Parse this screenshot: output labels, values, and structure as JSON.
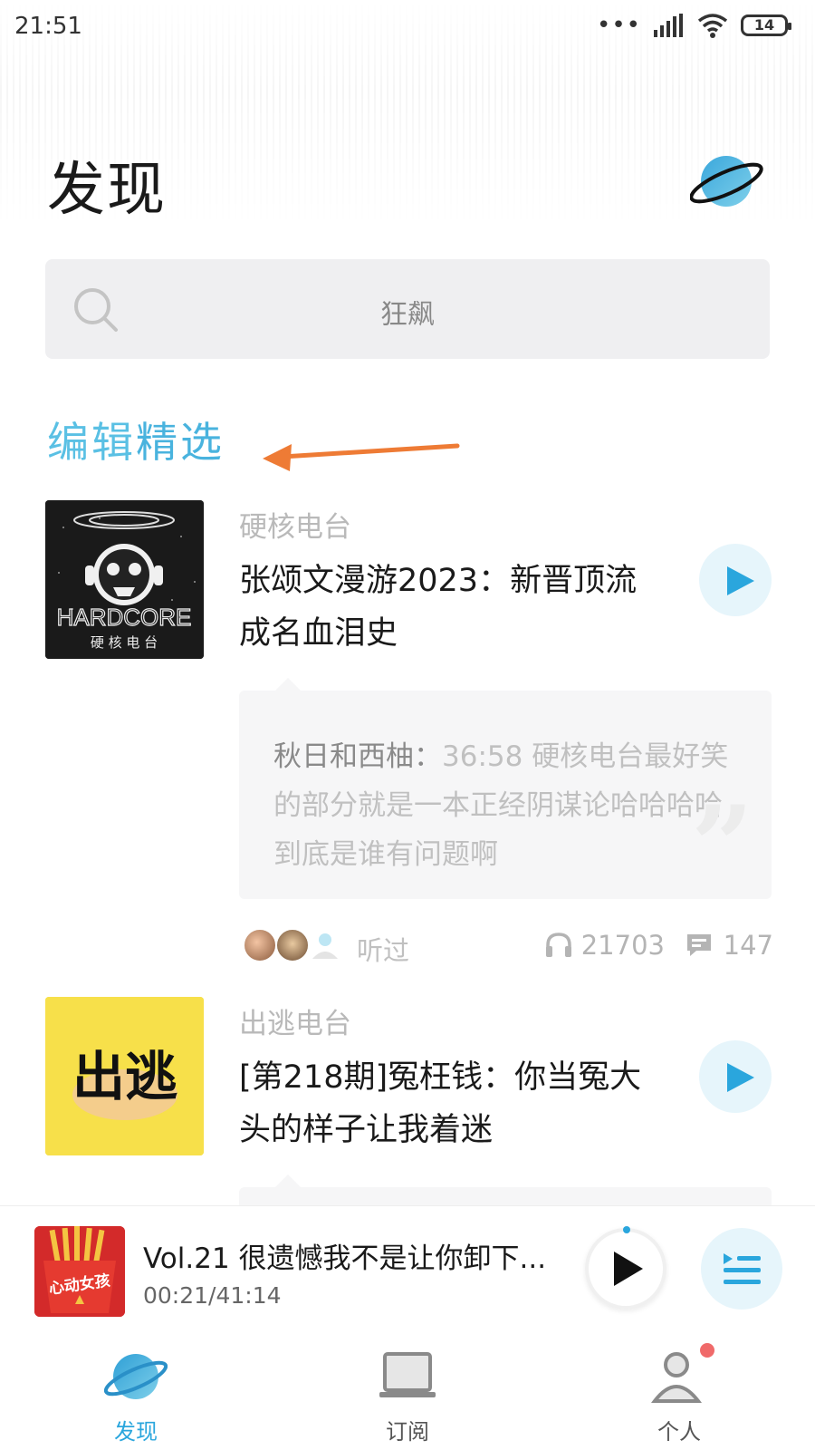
{
  "status_bar": {
    "time": "21:51",
    "battery": "14"
  },
  "header": {
    "title": "发现"
  },
  "search": {
    "placeholder": "狂飙"
  },
  "section": {
    "title_part1": "编辑",
    "title_part2": "精选"
  },
  "episodes": [
    {
      "channel": "硬核电台",
      "title": "张颂文漫游2023：新晋顶流成名血泪史",
      "cover_text": "HARDCORE",
      "cover_subtext": "硬 核 电 台",
      "comment": {
        "author": "秋日和西柚：",
        "text": "36:58 硬核电台最好笑的部分就是一本正经阴谋论哈哈哈哈到底是谁有问题啊"
      },
      "listened_label": "听过",
      "plays": "21703",
      "comments": "147"
    },
    {
      "channel": "出逃电台",
      "title": "[第218期]冤枉钱：你当冤大头的样子让我着迷",
      "cover_text": "出逃"
    }
  ],
  "mini_player": {
    "title": "Vol.21 很遗憾我不是让你卸下...",
    "time": "00:21/41:14",
    "cover_text": "心动女孩"
  },
  "bottom_nav": [
    {
      "label": "发现",
      "active": true
    },
    {
      "label": "订阅",
      "active": false
    },
    {
      "label": "个人",
      "active": false
    }
  ],
  "colors": {
    "accent": "#2aa6dd",
    "section_title": "#5ac0e4",
    "annotation_arrow": "#ee7b35"
  },
  "icons": [
    "planet-icon",
    "search-icon",
    "play-icon",
    "headphones-icon",
    "comment-icon",
    "playlist-icon",
    "subscribe-icon",
    "profile-icon"
  ]
}
